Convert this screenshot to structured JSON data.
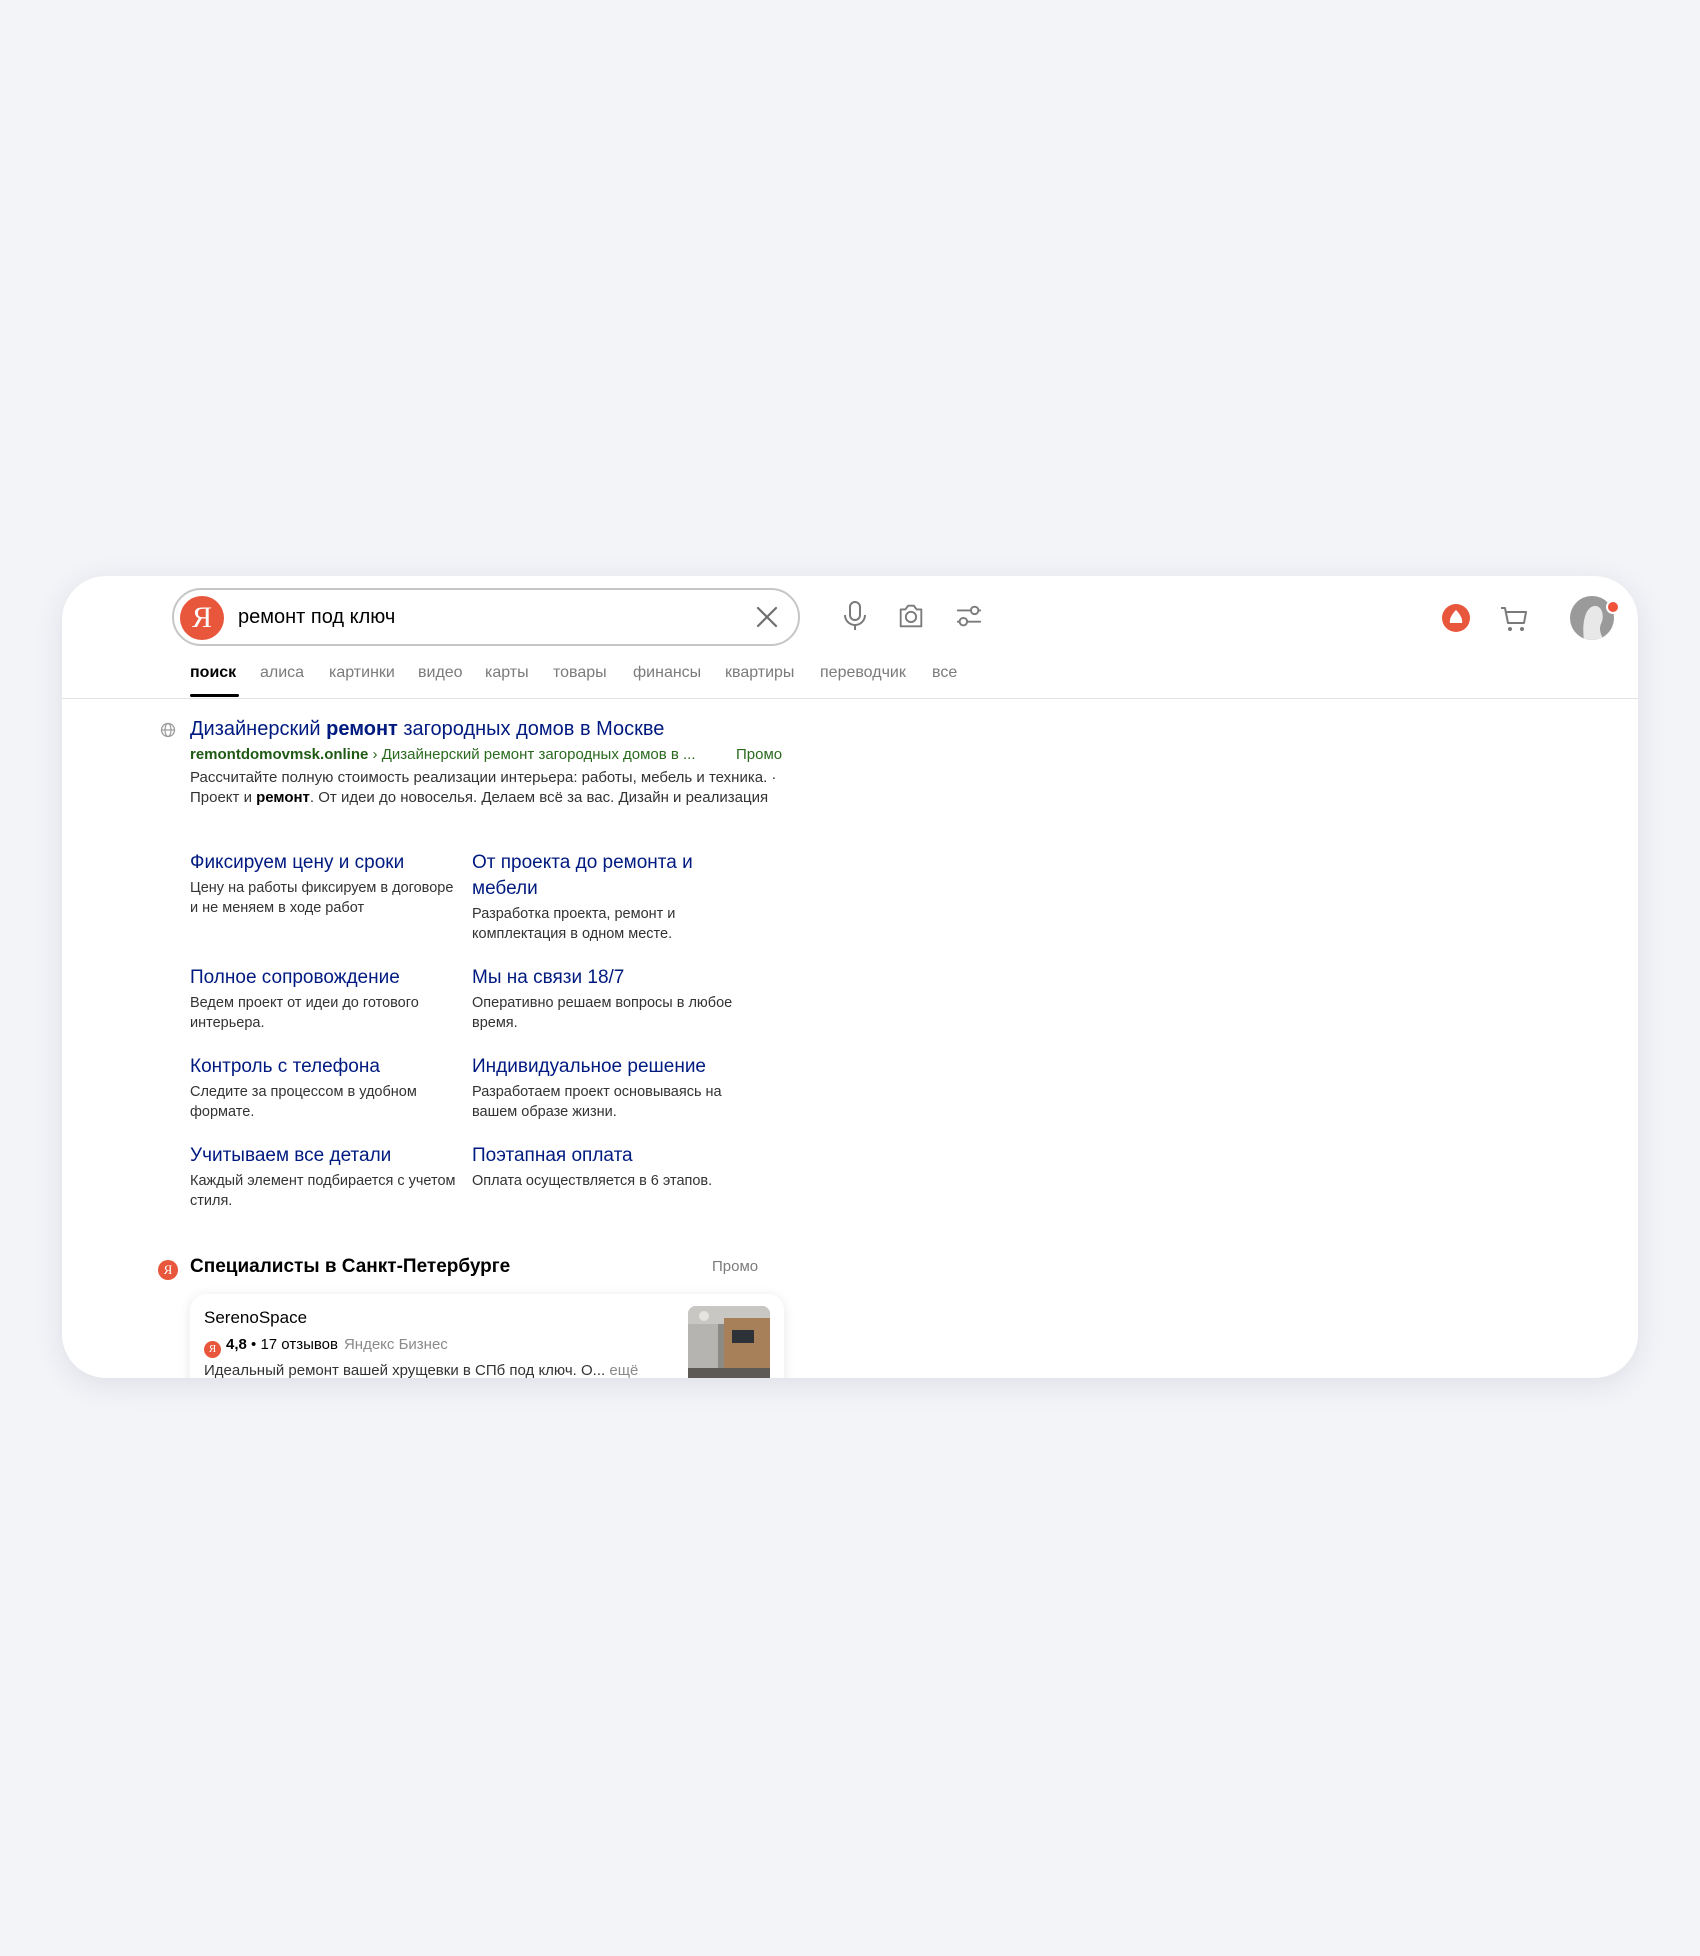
{
  "search": {
    "query": "ремонт под ключ"
  },
  "tabs": [
    {
      "label": "поиск"
    },
    {
      "label": "алиса"
    },
    {
      "label": "картинки"
    },
    {
      "label": "видео"
    },
    {
      "label": "карты"
    },
    {
      "label": "товары"
    },
    {
      "label": "финансы"
    },
    {
      "label": "квартиры"
    },
    {
      "label": "переводчик"
    },
    {
      "label": "все"
    }
  ],
  "result": {
    "title_pre": "Дизайнерский ",
    "title_bold": "ремонт",
    "title_post": " загородных домов в Москве",
    "url_domain": "remontdomovmsk.online",
    "url_path": " › Дизайнерский ремонт загородных домов в ...",
    "promo_label": "Промо",
    "snippet_1": "Рассчитайте полную стоимость реализации интерьера: работы, мебель и техника. · Проект и ",
    "snippet_bold": "ремонт",
    "snippet_2": ". От идеи до новоселья. Делаем всё за вас. Дизайн и реализация",
    "sitelinks": [
      {
        "title": "Фиксируем цену и сроки",
        "desc": "Цену на работы фиксируем в договоре и не меняем в ходе работ"
      },
      {
        "title": "От проекта до ремонта и мебели",
        "desc": "Разработка проекта, ремонт и комплектация в одном месте."
      },
      {
        "title": "Полное сопровождение",
        "desc": "Ведем проект от идеи до готового интерьера."
      },
      {
        "title": "Мы на связи 18/7",
        "desc": "Оперативно решаем вопросы в любое время."
      },
      {
        "title": "Контроль с телефона",
        "desc": "Следите за процессом в удобном формате."
      },
      {
        "title": "Индивидуальное решение",
        "desc": "Разработаем проект основываясь на вашем образе жизни."
      },
      {
        "title": "Учитываем все детали",
        "desc": "Каждый элемент подбирается с учетом стиля."
      },
      {
        "title": "Поэтапная оплата",
        "desc": "Оплата осуществляется в 6 этапов."
      }
    ]
  },
  "specialists": {
    "title": "Специалисты в Санкт-Петербурге",
    "promo_label": "Промо",
    "business": {
      "name": "SerenoSpace",
      "rating": "4,8",
      "separator": " • ",
      "reviews": "17 отзывов",
      "source": "Яндекс Бизнес",
      "desc": "Идеальный ремонт вашей хрущевки в СПб под ключ. О...",
      "more": "ещё"
    }
  },
  "logo_letter": "Я",
  "colors": {
    "brand_red": "#e8573c",
    "link_blue": "#001a80",
    "url_green": "#2a6a1e",
    "page_bg": "#f3f4f8"
  }
}
